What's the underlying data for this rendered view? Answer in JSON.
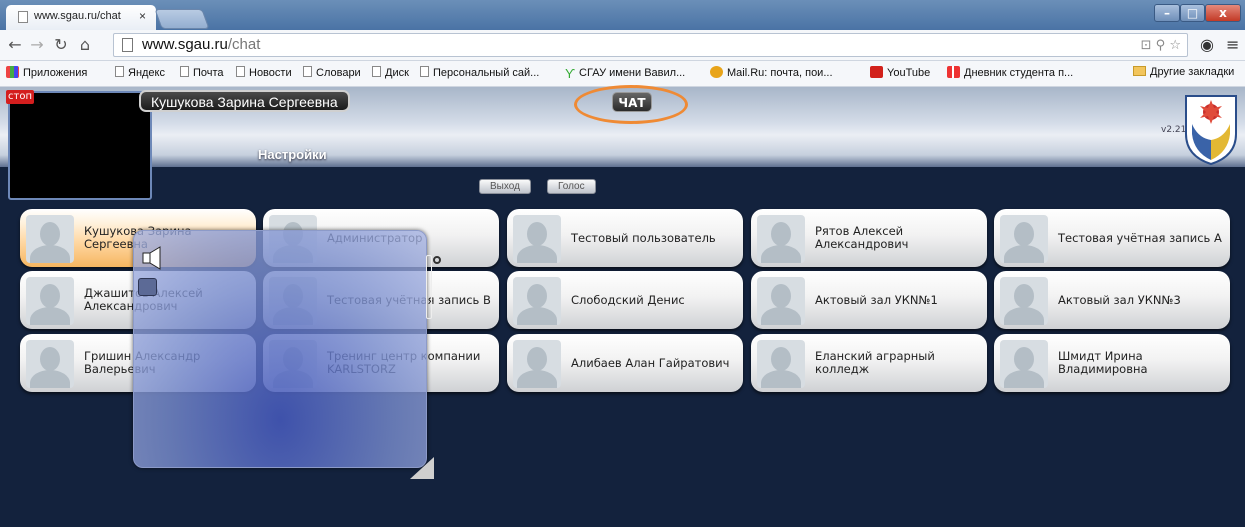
{
  "browser": {
    "tab_title": "www.sgau.ru/chat",
    "tab_close": "×",
    "url_host": "www.sgau.ru",
    "url_path": "/chat",
    "bookmarks": [
      "Приложения",
      "Яндекс",
      "Почта",
      "Новости",
      "Словари",
      "Диск",
      "Персональный сай...",
      "СГАУ имени Вавил...",
      "Mail.Ru: почта, пои...",
      "YouTube",
      "Дневник студента п...",
      "Другие закладки"
    ]
  },
  "app": {
    "stop_label": "стоп",
    "user_name": "Кушукова Зарина Сергеевна",
    "chat_label": "ЧАТ",
    "settings_label": "Настройки",
    "version": "v2.21",
    "exit_button": "Выход",
    "voice_button": "Голос",
    "accent_color": "#ef8a34"
  },
  "contacts": [
    {
      "name": "Кушукова Зарина Сергеевна"
    },
    {
      "name": "Администратор"
    },
    {
      "name": "Тестовый пользователь"
    },
    {
      "name": "Рятов Алексей Александрович"
    },
    {
      "name": "Тестовая учётная запись А"
    },
    {
      "name": "Джашитов Алексей Александрович"
    },
    {
      "name": "Тестовая учётная запись В"
    },
    {
      "name": "Слободский Денис"
    },
    {
      "name": "Актовый зал УКN№1"
    },
    {
      "name": "Актовый зал УКN№3"
    },
    {
      "name": "Гришин Александр Валерьевич"
    },
    {
      "name": "Тренинг центр компании KARLSTORZ"
    },
    {
      "name": "Алибаев Алан Гайратович"
    },
    {
      "name": "Еланский аграрный колледж"
    },
    {
      "name": "Шмидт Ирина Владимировна"
    }
  ]
}
